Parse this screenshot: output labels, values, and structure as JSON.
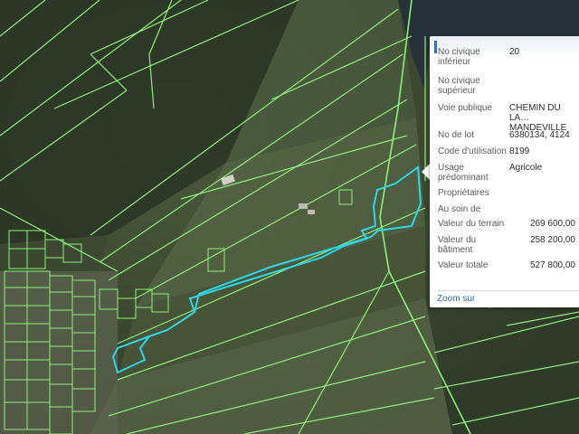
{
  "map": {
    "parcel_line_color": "#8df07a",
    "selected_parcel_color": "#2fd7e6",
    "water_color": "#26313a"
  },
  "popup": {
    "rows": [
      {
        "label": "No civique inférieur",
        "value": "20"
      },
      {
        "label": "No civique supérieur",
        "value": ""
      },
      {
        "label": "Voie publique",
        "value": "CHEMIN DU LA… MANDEVILLE"
      },
      {
        "label": "No de lot",
        "value": "6380134, 4124"
      },
      {
        "label": "Code d'utilisation",
        "value": "8199"
      },
      {
        "label": "Usage prédominant",
        "value": "Agricole"
      },
      {
        "label": "Propriétaires",
        "value": ""
      },
      {
        "label": "Au soin de",
        "value": ""
      },
      {
        "label": "Valeur du terrain",
        "value": "269 600,00"
      },
      {
        "label": "Valeur du bâtiment",
        "value": "258 200,00"
      },
      {
        "label": "Valeur totale",
        "value": "527 800,00"
      }
    ],
    "zoom_link": "Zoom sur"
  }
}
